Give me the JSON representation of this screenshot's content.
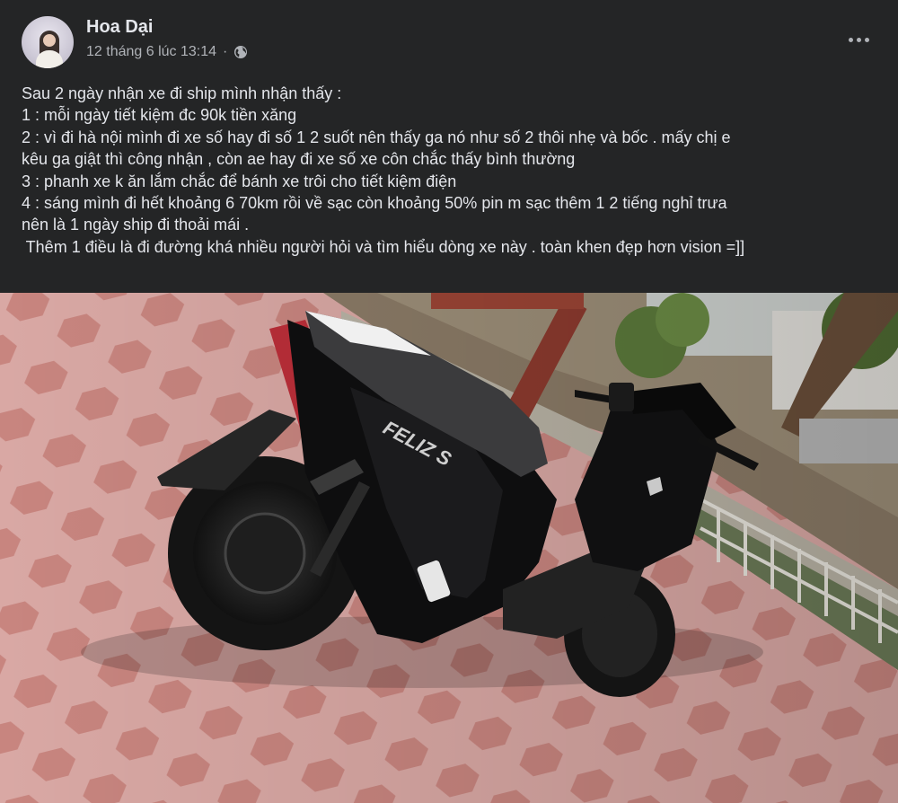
{
  "post": {
    "author": "Hoa Dại",
    "timestamp": "12 tháng 6 lúc 13:14",
    "separator": "·",
    "privacy_icon": "globe-icon",
    "menu_icon": "more-horizontal-icon",
    "lines": [
      "Sau 2 ngày nhận xe đi ship mình nhận thấy :",
      "1 : mỗi ngày tiết kiệm đc 90k tiền xăng",
      "2 : vì đi hà nội mình đi xe số hay đi số 1 2 suốt nên thấy ga nó như số 2 thôi nhẹ và bốc . mấy chị e",
      "kêu ga giật thì công nhận , còn ae hay đi xe số xe côn chắc thấy bình thường",
      "3 : phanh xe k ăn lắm chắc để bánh xe trôi cho tiết kiệm điện",
      "4 : sáng mình đi hết khoảng 6 70km rồi về sạc còn khoảng 50% pin m sạc thêm 1 2 tiếng nghỉ trưa",
      "nên là 1 ngày ship đi thoải mái .",
      " Thêm 1 điều là đi đường khá nhiều người hỏi và tìm hiểu dòng xe này . toàn khen đẹp hơn vision =]]"
    ],
    "photo": {
      "model_badge": "FELIZ S"
    }
  },
  "colors": {
    "background": "#242526",
    "text_primary": "#e4e6eb",
    "text_secondary": "#b0b3b8"
  }
}
